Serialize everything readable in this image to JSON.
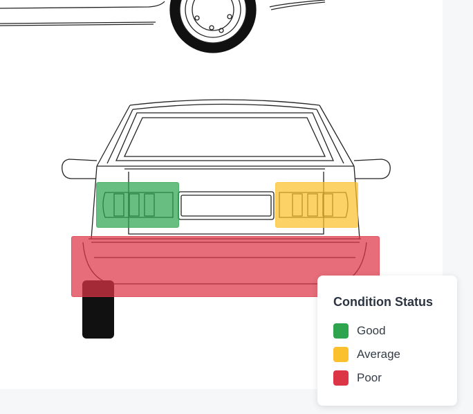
{
  "legend": {
    "title": "Condition Status",
    "items": [
      {
        "label": "Good",
        "color": "#2ea44f"
      },
      {
        "label": "Average",
        "color": "#fbc02d"
      },
      {
        "label": "Poor",
        "color": "#dc3545"
      }
    ]
  },
  "zones": [
    {
      "part": "left-tail-light",
      "status": "Good",
      "color": "#2ea44f"
    },
    {
      "part": "right-tail-light",
      "status": "Average",
      "color": "#fbc02d"
    },
    {
      "part": "rear-bumper",
      "status": "Poor",
      "color": "#dc3545"
    }
  ]
}
